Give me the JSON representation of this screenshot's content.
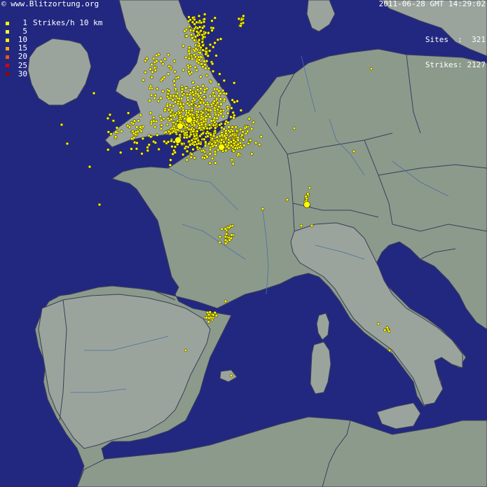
{
  "header": {
    "credit_prefix": "©",
    "credit": "www.Blitzortung.org",
    "timestamp": "2011-06-28 GMT 14:29:02"
  },
  "stats": {
    "sites_label": "Sites",
    "sites_value": "321",
    "strikes_label": "Strikes:",
    "strikes_value": "2127"
  },
  "legend": {
    "unit": "Strikes/h 10 km",
    "entries": [
      {
        "value": "1",
        "color": "#ffff00"
      },
      {
        "value": "5",
        "color": "#ffff33"
      },
      {
        "value": "10",
        "color": "#ffee00"
      },
      {
        "value": "15",
        "color": "#ffaa00"
      },
      {
        "value": "20",
        "color": "#ff5500"
      },
      {
        "value": "25",
        "color": "#dd0000"
      },
      {
        "value": "30",
        "color": "#990000"
      }
    ]
  },
  "colors": {
    "sea": "#222880",
    "land": "#8c9a8c",
    "land_alt": "#9aa49c",
    "outside_land": "#a5a89f",
    "border": "#3a3e5a",
    "river": "#4f6fa0",
    "strike": "#ffff00",
    "strike_outline": "#3a3000"
  }
}
